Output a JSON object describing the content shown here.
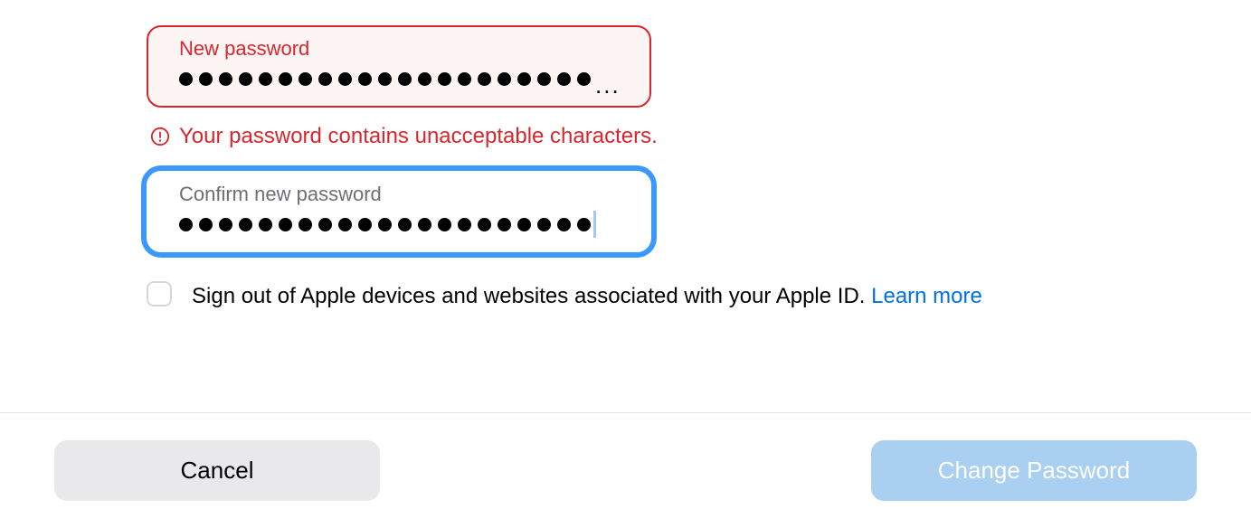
{
  "fields": {
    "new_password": {
      "label": "New password",
      "masked_dot_count": 21,
      "truncated": true
    },
    "confirm_password": {
      "label": "Confirm new password",
      "masked_dot_count": 21,
      "has_cursor": true
    }
  },
  "error": {
    "message": "Your password contains unacceptable characters."
  },
  "signout_option": {
    "label_text": "Sign out of Apple devices and websites associated with your Apple ID. ",
    "learn_more": "Learn more",
    "checked": false
  },
  "buttons": {
    "cancel": "Cancel",
    "submit": "Change Password"
  },
  "colors": {
    "error": "#d9262c",
    "focus_ring": "#3b99fc",
    "link": "#0071e3",
    "primary_disabled": "#a9cff1",
    "cancel_bg": "#e9e9eb"
  }
}
